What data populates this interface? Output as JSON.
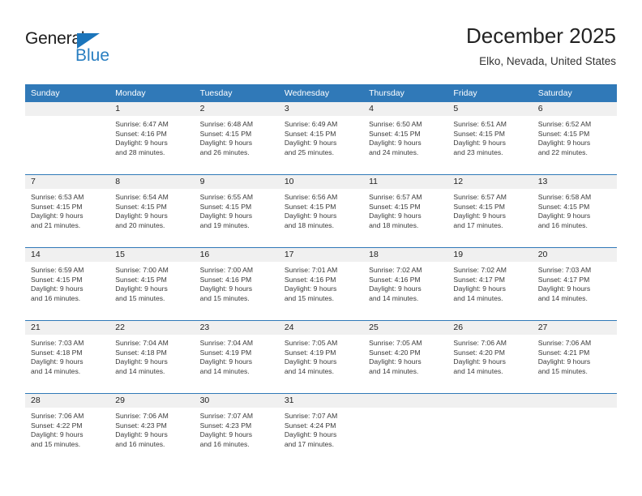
{
  "brand": {
    "name_part1": "General",
    "name_part2": "Blue",
    "triangle_icon": "triangle-icon",
    "color_primary": "#2a7fc1",
    "color_dark": "#1c1c1c"
  },
  "header": {
    "title": "December 2025",
    "location": "Elko, Nevada, United States",
    "accent_color": "#3079b8",
    "daynum_bg": "#f0f0f0"
  },
  "weekdays": [
    "Sunday",
    "Monday",
    "Tuesday",
    "Wednesday",
    "Thursday",
    "Friday",
    "Saturday"
  ],
  "labels": {
    "sunrise_prefix": "Sunrise:",
    "sunset_prefix": "Sunset:",
    "daylight_prefix": "Daylight:"
  },
  "weeks": [
    [
      {
        "day": "",
        "blank": true,
        "sunrise": "",
        "sunset": "",
        "daylight_a": "",
        "daylight_b": ""
      },
      {
        "day": "1",
        "sunrise": "Sunrise: 6:47 AM",
        "sunset": "Sunset: 4:16 PM",
        "daylight_a": "Daylight: 9 hours",
        "daylight_b": "and 28 minutes."
      },
      {
        "day": "2",
        "sunrise": "Sunrise: 6:48 AM",
        "sunset": "Sunset: 4:15 PM",
        "daylight_a": "Daylight: 9 hours",
        "daylight_b": "and 26 minutes."
      },
      {
        "day": "3",
        "sunrise": "Sunrise: 6:49 AM",
        "sunset": "Sunset: 4:15 PM",
        "daylight_a": "Daylight: 9 hours",
        "daylight_b": "and 25 minutes."
      },
      {
        "day": "4",
        "sunrise": "Sunrise: 6:50 AM",
        "sunset": "Sunset: 4:15 PM",
        "daylight_a": "Daylight: 9 hours",
        "daylight_b": "and 24 minutes."
      },
      {
        "day": "5",
        "sunrise": "Sunrise: 6:51 AM",
        "sunset": "Sunset: 4:15 PM",
        "daylight_a": "Daylight: 9 hours",
        "daylight_b": "and 23 minutes."
      },
      {
        "day": "6",
        "sunrise": "Sunrise: 6:52 AM",
        "sunset": "Sunset: 4:15 PM",
        "daylight_a": "Daylight: 9 hours",
        "daylight_b": "and 22 minutes."
      }
    ],
    [
      {
        "day": "7",
        "sunrise": "Sunrise: 6:53 AM",
        "sunset": "Sunset: 4:15 PM",
        "daylight_a": "Daylight: 9 hours",
        "daylight_b": "and 21 minutes."
      },
      {
        "day": "8",
        "sunrise": "Sunrise: 6:54 AM",
        "sunset": "Sunset: 4:15 PM",
        "daylight_a": "Daylight: 9 hours",
        "daylight_b": "and 20 minutes."
      },
      {
        "day": "9",
        "sunrise": "Sunrise: 6:55 AM",
        "sunset": "Sunset: 4:15 PM",
        "daylight_a": "Daylight: 9 hours",
        "daylight_b": "and 19 minutes."
      },
      {
        "day": "10",
        "sunrise": "Sunrise: 6:56 AM",
        "sunset": "Sunset: 4:15 PM",
        "daylight_a": "Daylight: 9 hours",
        "daylight_b": "and 18 minutes."
      },
      {
        "day": "11",
        "sunrise": "Sunrise: 6:57 AM",
        "sunset": "Sunset: 4:15 PM",
        "daylight_a": "Daylight: 9 hours",
        "daylight_b": "and 18 minutes."
      },
      {
        "day": "12",
        "sunrise": "Sunrise: 6:57 AM",
        "sunset": "Sunset: 4:15 PM",
        "daylight_a": "Daylight: 9 hours",
        "daylight_b": "and 17 minutes."
      },
      {
        "day": "13",
        "sunrise": "Sunrise: 6:58 AM",
        "sunset": "Sunset: 4:15 PM",
        "daylight_a": "Daylight: 9 hours",
        "daylight_b": "and 16 minutes."
      }
    ],
    [
      {
        "day": "14",
        "sunrise": "Sunrise: 6:59 AM",
        "sunset": "Sunset: 4:15 PM",
        "daylight_a": "Daylight: 9 hours",
        "daylight_b": "and 16 minutes."
      },
      {
        "day": "15",
        "sunrise": "Sunrise: 7:00 AM",
        "sunset": "Sunset: 4:15 PM",
        "daylight_a": "Daylight: 9 hours",
        "daylight_b": "and 15 minutes."
      },
      {
        "day": "16",
        "sunrise": "Sunrise: 7:00 AM",
        "sunset": "Sunset: 4:16 PM",
        "daylight_a": "Daylight: 9 hours",
        "daylight_b": "and 15 minutes."
      },
      {
        "day": "17",
        "sunrise": "Sunrise: 7:01 AM",
        "sunset": "Sunset: 4:16 PM",
        "daylight_a": "Daylight: 9 hours",
        "daylight_b": "and 15 minutes."
      },
      {
        "day": "18",
        "sunrise": "Sunrise: 7:02 AM",
        "sunset": "Sunset: 4:16 PM",
        "daylight_a": "Daylight: 9 hours",
        "daylight_b": "and 14 minutes."
      },
      {
        "day": "19",
        "sunrise": "Sunrise: 7:02 AM",
        "sunset": "Sunset: 4:17 PM",
        "daylight_a": "Daylight: 9 hours",
        "daylight_b": "and 14 minutes."
      },
      {
        "day": "20",
        "sunrise": "Sunrise: 7:03 AM",
        "sunset": "Sunset: 4:17 PM",
        "daylight_a": "Daylight: 9 hours",
        "daylight_b": "and 14 minutes."
      }
    ],
    [
      {
        "day": "21",
        "sunrise": "Sunrise: 7:03 AM",
        "sunset": "Sunset: 4:18 PM",
        "daylight_a": "Daylight: 9 hours",
        "daylight_b": "and 14 minutes."
      },
      {
        "day": "22",
        "sunrise": "Sunrise: 7:04 AM",
        "sunset": "Sunset: 4:18 PM",
        "daylight_a": "Daylight: 9 hours",
        "daylight_b": "and 14 minutes."
      },
      {
        "day": "23",
        "sunrise": "Sunrise: 7:04 AM",
        "sunset": "Sunset: 4:19 PM",
        "daylight_a": "Daylight: 9 hours",
        "daylight_b": "and 14 minutes."
      },
      {
        "day": "24",
        "sunrise": "Sunrise: 7:05 AM",
        "sunset": "Sunset: 4:19 PM",
        "daylight_a": "Daylight: 9 hours",
        "daylight_b": "and 14 minutes."
      },
      {
        "day": "25",
        "sunrise": "Sunrise: 7:05 AM",
        "sunset": "Sunset: 4:20 PM",
        "daylight_a": "Daylight: 9 hours",
        "daylight_b": "and 14 minutes."
      },
      {
        "day": "26",
        "sunrise": "Sunrise: 7:06 AM",
        "sunset": "Sunset: 4:20 PM",
        "daylight_a": "Daylight: 9 hours",
        "daylight_b": "and 14 minutes."
      },
      {
        "day": "27",
        "sunrise": "Sunrise: 7:06 AM",
        "sunset": "Sunset: 4:21 PM",
        "daylight_a": "Daylight: 9 hours",
        "daylight_b": "and 15 minutes."
      }
    ],
    [
      {
        "day": "28",
        "sunrise": "Sunrise: 7:06 AM",
        "sunset": "Sunset: 4:22 PM",
        "daylight_a": "Daylight: 9 hours",
        "daylight_b": "and 15 minutes."
      },
      {
        "day": "29",
        "sunrise": "Sunrise: 7:06 AM",
        "sunset": "Sunset: 4:23 PM",
        "daylight_a": "Daylight: 9 hours",
        "daylight_b": "and 16 minutes."
      },
      {
        "day": "30",
        "sunrise": "Sunrise: 7:07 AM",
        "sunset": "Sunset: 4:23 PM",
        "daylight_a": "Daylight: 9 hours",
        "daylight_b": "and 16 minutes."
      },
      {
        "day": "31",
        "sunrise": "Sunrise: 7:07 AM",
        "sunset": "Sunset: 4:24 PM",
        "daylight_a": "Daylight: 9 hours",
        "daylight_b": "and 17 minutes."
      },
      {
        "day": "",
        "blank": true,
        "sunrise": "",
        "sunset": "",
        "daylight_a": "",
        "daylight_b": ""
      },
      {
        "day": "",
        "blank": true,
        "sunrise": "",
        "sunset": "",
        "daylight_a": "",
        "daylight_b": ""
      },
      {
        "day": "",
        "blank": true,
        "sunrise": "",
        "sunset": "",
        "daylight_a": "",
        "daylight_b": ""
      }
    ]
  ]
}
